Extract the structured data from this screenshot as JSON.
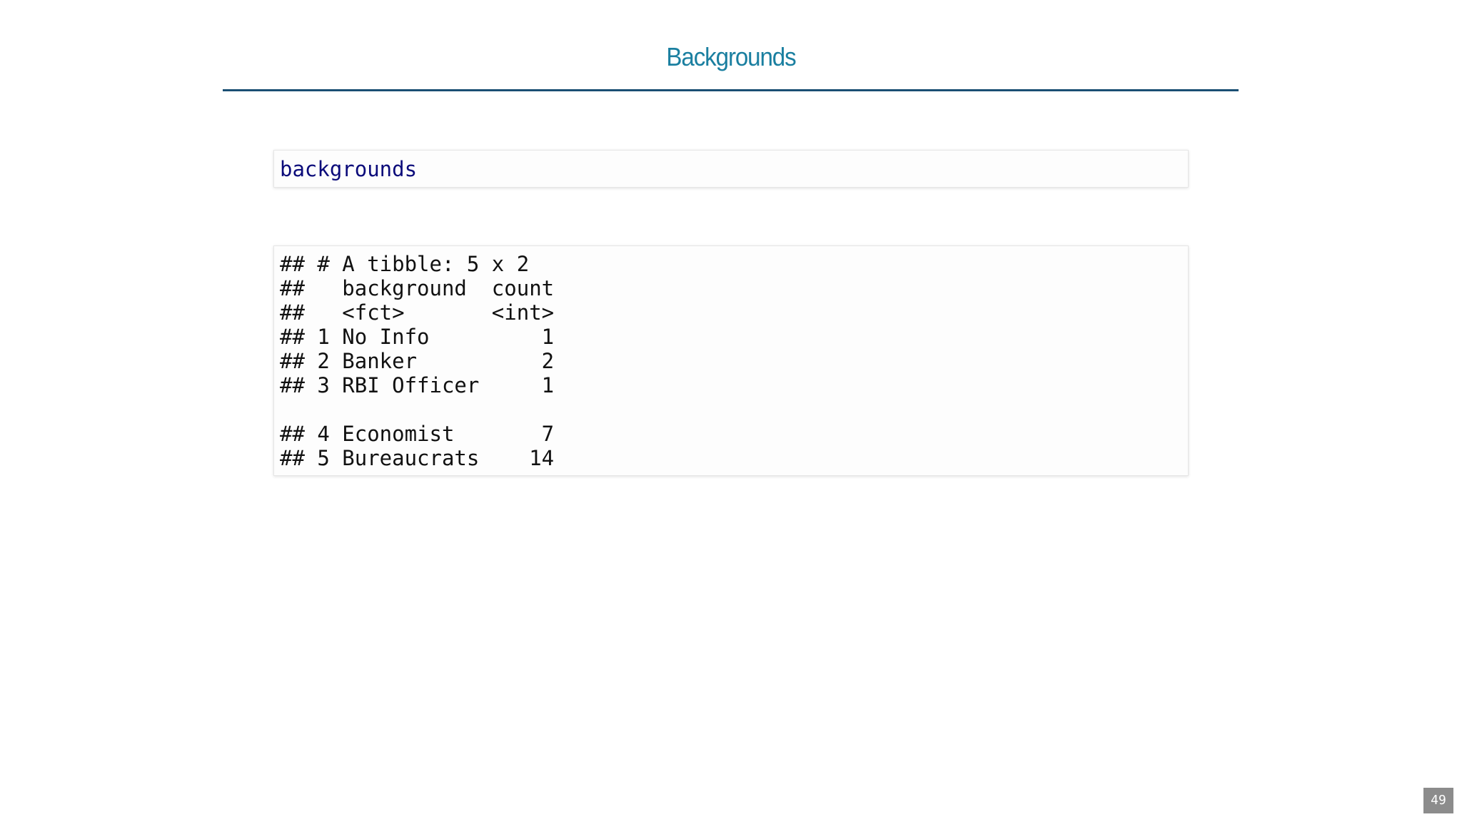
{
  "slide": {
    "title": "Backgrounds",
    "code_input": "backgrounds",
    "code_output": [
      "## # A tibble: 5 x 2",
      "##   background  count",
      "##   <fct>       <int>",
      "## 1 No Info         1",
      "## 2 Banker          2",
      "## 3 RBI Officer     1",
      "",
      "## 4 Economist       7",
      "## 5 Bureaucrats    14"
    ],
    "page_number": "49"
  },
  "colors": {
    "title": "#1a7fa0",
    "rule": "#1a4f73",
    "code_input_text": "#0b0b7a",
    "page_number_bg": "#8c8c8c"
  }
}
